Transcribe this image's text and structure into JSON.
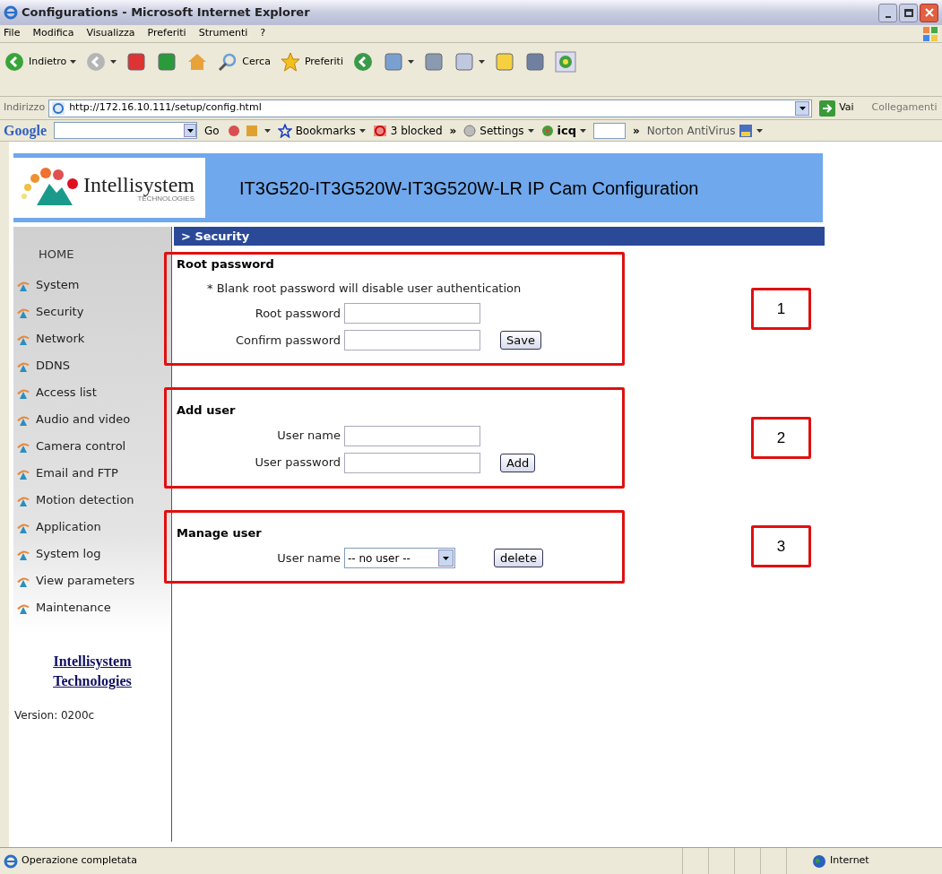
{
  "window": {
    "title": "Configurations - Microsoft Internet Explorer"
  },
  "menu": [
    "File",
    "Modifica",
    "Visualizza",
    "Preferiti",
    "Strumenti",
    "?"
  ],
  "toolbar": [
    {
      "kind": "back",
      "label": "Indietro",
      "dropdown": true
    },
    {
      "kind": "forward",
      "dropdown": true
    },
    {
      "kind": "stop",
      "dropdown": false
    },
    {
      "kind": "refresh",
      "dropdown": false
    },
    {
      "kind": "home",
      "dropdown": false
    },
    {
      "kind": "search",
      "label": "Cerca",
      "dropdown": false
    },
    {
      "kind": "favorites",
      "label": "Preferiti",
      "dropdown": false
    },
    {
      "kind": "history",
      "dropdown": false
    },
    {
      "kind": "mail",
      "dropdown": true
    },
    {
      "kind": "print",
      "dropdown": false
    },
    {
      "kind": "word",
      "dropdown": true
    },
    {
      "kind": "notes",
      "dropdown": false
    },
    {
      "kind": "research",
      "dropdown": false
    },
    {
      "kind": "messenger",
      "dropdown": false
    }
  ],
  "address": {
    "label": "Indirizzo",
    "url": "http://172.16.10.111/setup/config.html",
    "go": "Vai",
    "links": "Collegamenti"
  },
  "google_bar": {
    "logo": "Google",
    "items": [
      {
        "kind": "go",
        "label": "Go"
      },
      {
        "kind": "tools"
      },
      {
        "kind": "bookmarks",
        "label": "Bookmarks"
      },
      {
        "kind": "popup",
        "label": "3 blocked"
      },
      {
        "kind": "more",
        "label": "»"
      },
      {
        "kind": "settings",
        "label": "Settings"
      },
      {
        "kind": "icq",
        "label": "icq"
      },
      {
        "kind": "field"
      },
      {
        "kind": "more",
        "label": "»"
      },
      {
        "kind": "norton",
        "label": "Norton AntiVirus"
      }
    ]
  },
  "page": {
    "logo": {
      "name": "Intellisystem",
      "tagline": "TECHNOLOGIES"
    },
    "title": "IT3G520-IT3G520W-IT3G520W-LR IP Cam Configuration",
    "section": "> Security",
    "sidebar": {
      "home": "HOME",
      "items": [
        "System",
        "Security",
        "Network",
        "DDNS",
        "Access list",
        "Audio and video",
        "Camera control",
        "Email and FTP",
        "Motion detection",
        "Application",
        "System log",
        "View parameters",
        "Maintenance"
      ],
      "link": [
        "Intellisystem",
        "Technologies"
      ],
      "version": "Version: 0200c"
    },
    "groups": [
      {
        "heading": "Root password",
        "note": "* Blank root password will disable user authentication",
        "fields": [
          {
            "kind": "input",
            "label": "Root password"
          },
          {
            "kind": "input",
            "label": "Confirm password",
            "button": "Save"
          }
        ],
        "annotation": "1"
      },
      {
        "heading": "Add user",
        "fields": [
          {
            "kind": "input",
            "label": "User name"
          },
          {
            "kind": "input",
            "label": "User password",
            "button": "Add"
          }
        ],
        "annotation": "2"
      },
      {
        "heading": "Manage user",
        "fields": [
          {
            "kind": "select",
            "label": "User name",
            "value": "-- no user --",
            "button": "delete"
          }
        ],
        "annotation": "3"
      }
    ]
  },
  "status_bar": {
    "text": "Operazione completata",
    "zone": "Internet"
  }
}
